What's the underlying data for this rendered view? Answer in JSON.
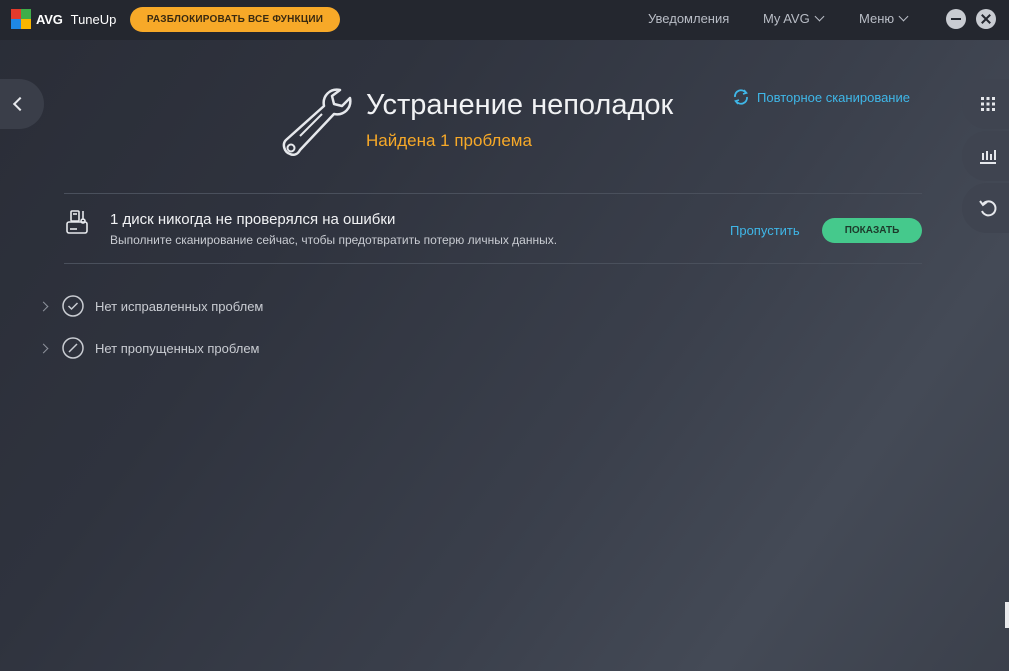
{
  "app": {
    "brand": "AVG",
    "product": "TuneUp",
    "unlock_label": "РАЗБЛОКИРОВАТЬ ВСЕ ФУНКЦИИ"
  },
  "topnav": {
    "notifications": "Уведомления",
    "my_avg": "My AVG",
    "menu": "Меню"
  },
  "header": {
    "title": "Устранение неполадок",
    "subtitle": "Найдена 1 проблема",
    "rescan_label": "Повторное сканирование"
  },
  "issue": {
    "title": "1 диск никогда не проверялся на ошибки",
    "description": "Выполните сканирование сейчас, чтобы предотвратить потерю личных данных.",
    "skip_label": "Пропустить",
    "show_label": "ПОКАЗАТЬ"
  },
  "sections": [
    {
      "label": "Нет исправленных проблем",
      "icon": "check-circle-icon"
    },
    {
      "label": "Нет пропущенных проблем",
      "icon": "slash-circle-icon"
    }
  ],
  "sidebar": {
    "icons": [
      "grid-icon",
      "bar-chart-icon",
      "undo-icon"
    ]
  },
  "colors": {
    "accent_orange": "#f7a928",
    "link_blue": "#3fb7e8",
    "action_green": "#45c98c"
  }
}
